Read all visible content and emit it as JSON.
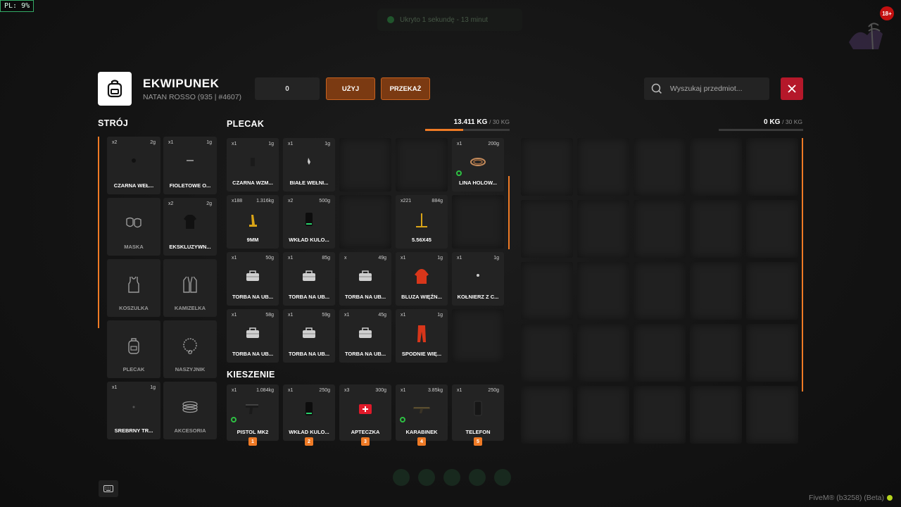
{
  "overlay": {
    "pl_label": "PL: 9%",
    "notice_text": "Ukryto 1 sekundę - 13 minut",
    "age_badge": "18+"
  },
  "header": {
    "title": "EKWIPUNEK",
    "subtitle": "NATAN ROSSO (935 | #4607)",
    "quantity_value": "0",
    "use_label": "UŻYJ",
    "give_label": "PRZEKAŻ",
    "search_placeholder": "Wyszukaj przedmiot..."
  },
  "outfit": {
    "title": "STRÓJ",
    "slots": [
      {
        "name": "CZARNA WEŁ...",
        "count": "x2",
        "weight": "2g",
        "icon": "dot-icon"
      },
      {
        "name": "FIOLETOWE O...",
        "count": "x1",
        "weight": "1g",
        "icon": "glasses-icon"
      },
      {
        "name": "MASKA",
        "count": "",
        "weight": "",
        "icon": "mask-icon"
      },
      {
        "name": "EKSKLUZYWN...",
        "count": "x2",
        "weight": "2g",
        "icon": "shirt-icon"
      },
      {
        "name": "KOSZULKA",
        "count": "",
        "weight": "",
        "icon": "tanktop-icon"
      },
      {
        "name": "KAMIZELKA",
        "count": "",
        "weight": "",
        "icon": "vest-icon"
      },
      {
        "name": "PLECAK",
        "count": "",
        "weight": "",
        "icon": "backpack-icon"
      },
      {
        "name": "NASZYJNIK",
        "count": "",
        "weight": "",
        "icon": "necklace-icon"
      },
      {
        "name": "SREBRNY TR...",
        "count": "x1",
        "weight": "1g",
        "icon": "ring-icon"
      },
      {
        "name": "AKCESORIA",
        "count": "",
        "weight": "",
        "icon": "bracelet-icon"
      }
    ]
  },
  "backpack": {
    "title": "PLECAK",
    "weight": "13.411 KG",
    "max_weight": "/ 30 KG",
    "fill_ratio": 0.447,
    "items": [
      {
        "name": "CZARNA WZM...",
        "count": "x1",
        "weight": "1g",
        "icon": "glove-icon"
      },
      {
        "name": "BIAŁE WEŁNI...",
        "count": "x1",
        "weight": "1g",
        "icon": "sock-icon"
      },
      {
        "empty": true
      },
      {
        "empty": true
      },
      {
        "name": "LINA HOLOW...",
        "count": "x1",
        "weight": "200g",
        "icon": "rope-icon",
        "ring": true
      },
      {
        "name": "9MM",
        "count": "x188",
        "weight": "1.316kg",
        "icon": "ammo-icon"
      },
      {
        "name": "WKŁAD KULO...",
        "count": "x2",
        "weight": "500g",
        "icon": "plate-icon"
      },
      {
        "empty": true
      },
      {
        "name": "5.56X45",
        "count": "x221",
        "weight": "884g",
        "icon": "rifle-ammo-icon"
      },
      {
        "empty": true
      },
      {
        "name": "TORBA NA UB...",
        "count": "x1",
        "weight": "50g",
        "icon": "bag-icon"
      },
      {
        "name": "TORBA NA UB...",
        "count": "x1",
        "weight": "85g",
        "icon": "bag-icon"
      },
      {
        "name": "TORBA NA UB...",
        "count": "x",
        "weight": "49g",
        "icon": "bag-icon"
      },
      {
        "name": "BLUZA WIĘŹN...",
        "count": "x1",
        "weight": "1g",
        "icon": "hoodie-icon"
      },
      {
        "name": "KOŁNIERZ Z C...",
        "count": "x1",
        "weight": "1g",
        "icon": "collar-icon"
      },
      {
        "name": "TORBA NA UB...",
        "count": "x1",
        "weight": "58g",
        "icon": "bag-icon"
      },
      {
        "name": "TORBA NA UB...",
        "count": "x1",
        "weight": "59g",
        "icon": "bag-icon"
      },
      {
        "name": "TORBA NA UB...",
        "count": "x1",
        "weight": "45g",
        "icon": "bag-icon"
      },
      {
        "name": "SPODNIE WIĘ...",
        "count": "x1",
        "weight": "1g",
        "icon": "pants-icon"
      },
      {
        "empty": true
      }
    ]
  },
  "pockets": {
    "title": "KIESZENIE",
    "items": [
      {
        "name": "PISTOL MK2",
        "count": "x1",
        "weight": "1.084kg",
        "icon": "pistol-icon",
        "ring": true,
        "hotkey": "1"
      },
      {
        "name": "WKŁAD KULO...",
        "count": "x1",
        "weight": "250g",
        "icon": "plate-icon",
        "hotkey": "2"
      },
      {
        "name": "APTECZKA",
        "count": "x3",
        "weight": "300g",
        "icon": "medkit-icon",
        "hotkey": "3"
      },
      {
        "name": "KARABINEK",
        "count": "x1",
        "weight": "3.85kg",
        "icon": "rifle-icon",
        "ring": true,
        "hotkey": "4"
      },
      {
        "name": "TELEFON",
        "count": "x1",
        "weight": "250g",
        "icon": "phone-icon",
        "hotkey": "5"
      }
    ]
  },
  "ground": {
    "weight": "0 KG",
    "max_weight": "/ 30 KG",
    "fill_ratio": 0
  },
  "footer": {
    "build_label": "FiveM® (b3258) (Beta)"
  },
  "colors": {
    "accent": "#ef7a25",
    "button": "#7b3a12",
    "close": "#b5182a",
    "ring": "#2ec043"
  }
}
